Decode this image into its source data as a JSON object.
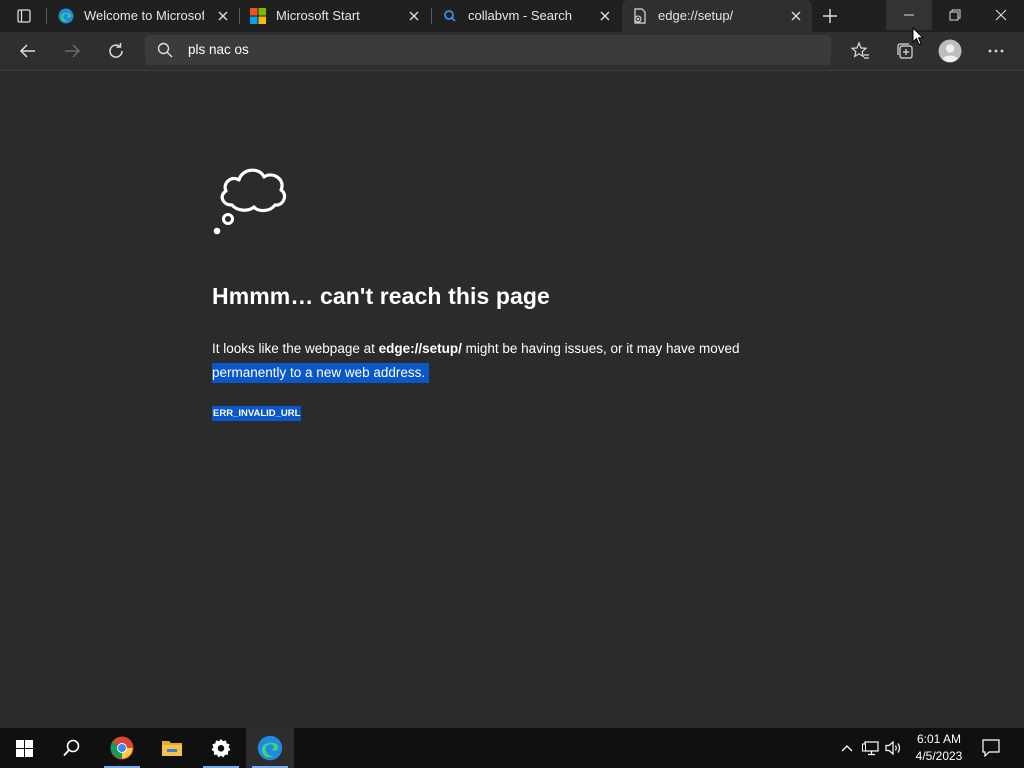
{
  "browser": {
    "tabs": [
      {
        "title": "Welcome to Microsoft E",
        "favicon": "edge-logo-icon"
      },
      {
        "title": "Microsoft Start",
        "favicon": "microsoft-logo-icon"
      },
      {
        "title": "collabvm - Search",
        "favicon": "bing-search-icon"
      },
      {
        "title": "edge://setup/",
        "favicon": "broken-page-icon",
        "active": true
      }
    ],
    "address_bar": {
      "value": "pls nac os"
    }
  },
  "error_page": {
    "heading": "Hmmm… can't reach this page",
    "body_prefix": "It looks like the webpage at ",
    "url": "edge://setup/",
    "body_suffix": " might be having issues, or it may have moved",
    "body_line2": "permanently to a new web address.",
    "error_code": "ERR_INVALID_URL"
  },
  "taskbar": {
    "apps": [
      "start-icon",
      "search-icon",
      "chrome-icon",
      "file-explorer-icon",
      "settings-icon",
      "edge-icon"
    ],
    "active_app": "edge-icon",
    "clock": {
      "time": "6:01 AM",
      "date": "4/5/2023"
    }
  },
  "colors": {
    "selection": "#0b57c8",
    "page_bg": "#2b2b2b",
    "tab_strip": "#202020"
  }
}
